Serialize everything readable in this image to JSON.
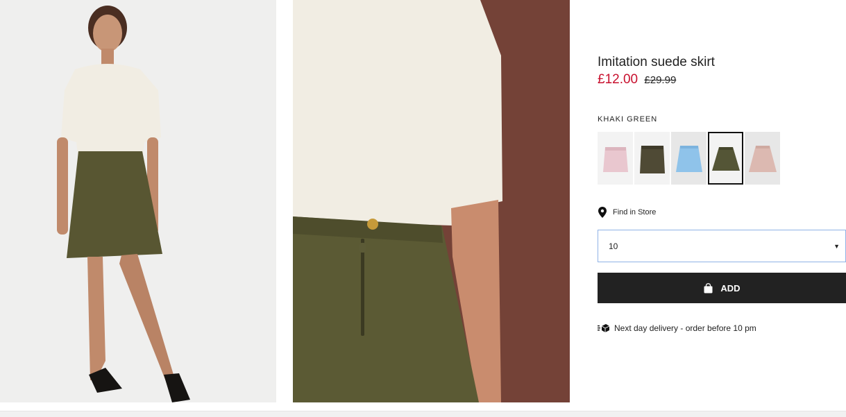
{
  "product": {
    "title": "Imitation suede skirt",
    "price_sale": "£12.00",
    "price_original": "£29.99",
    "sale_color": "#c8102e"
  },
  "color": {
    "selected_label": "KHAKI GREEN",
    "swatches": [
      {
        "name": "pink",
        "color": "#e9c7cf",
        "selected": false
      },
      {
        "name": "dark-khaki",
        "color": "#4f4a35",
        "selected": false
      },
      {
        "name": "light-blue",
        "color": "#8fc3ea",
        "selected": false
      },
      {
        "name": "khaki-green",
        "color": "#545536",
        "selected": true
      },
      {
        "name": "dusty-pink",
        "color": "#dcb9b1",
        "selected": false
      }
    ]
  },
  "store": {
    "label": "Find in Store",
    "icon": "location-pin-icon"
  },
  "size": {
    "value": "10",
    "icon": "caret-down-icon"
  },
  "cart": {
    "button_label": "ADD",
    "icon": "shopping-bag-icon"
  },
  "delivery": {
    "text": "Next day delivery - order before 10 pm",
    "icon": "delivery-truck-icon"
  }
}
